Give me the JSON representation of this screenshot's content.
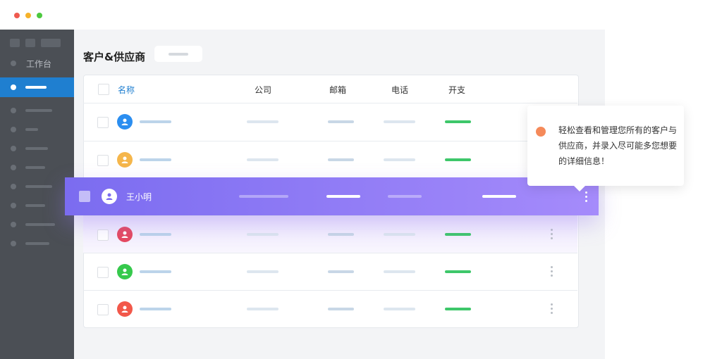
{
  "window": {
    "controls": [
      "close",
      "minimize",
      "maximize"
    ]
  },
  "sidebar": {
    "workbench_label": "工作台",
    "items": [
      {
        "icon": "dot-icon",
        "active": true
      },
      {
        "icon": "dot-icon"
      },
      {
        "icon": "dot-icon"
      },
      {
        "icon": "dot-icon"
      },
      {
        "icon": "dot-icon"
      },
      {
        "icon": "dot-icon"
      },
      {
        "icon": "dot-icon"
      },
      {
        "icon": "dot-icon"
      },
      {
        "icon": "dot-icon"
      }
    ]
  },
  "page": {
    "title": "客户&供应商"
  },
  "table": {
    "headers": {
      "name": "名称",
      "company": "公司",
      "email": "邮箱",
      "phone": "电话",
      "expense": "开支"
    },
    "rows": [
      {
        "avatar_color": "#2b8ef0"
      },
      {
        "avatar_color": "#f5b64b"
      },
      {
        "avatar_color": "#e5485f"
      },
      {
        "avatar_color": "#36c94c"
      },
      {
        "avatar_color": "#f2584a"
      }
    ],
    "highlighted_row": {
      "name": "王小明"
    }
  },
  "tooltip": {
    "text": "轻松查看和管理您所有的客户与供应商，并录入尽可能多您想要的详细信息！"
  },
  "colors": {
    "accent": "#1f7fd0",
    "highlight_start": "#7b6cf0",
    "highlight_end": "#a58bfb",
    "expense_green": "#3ec76a",
    "tip_dot": "#f58a5a"
  }
}
